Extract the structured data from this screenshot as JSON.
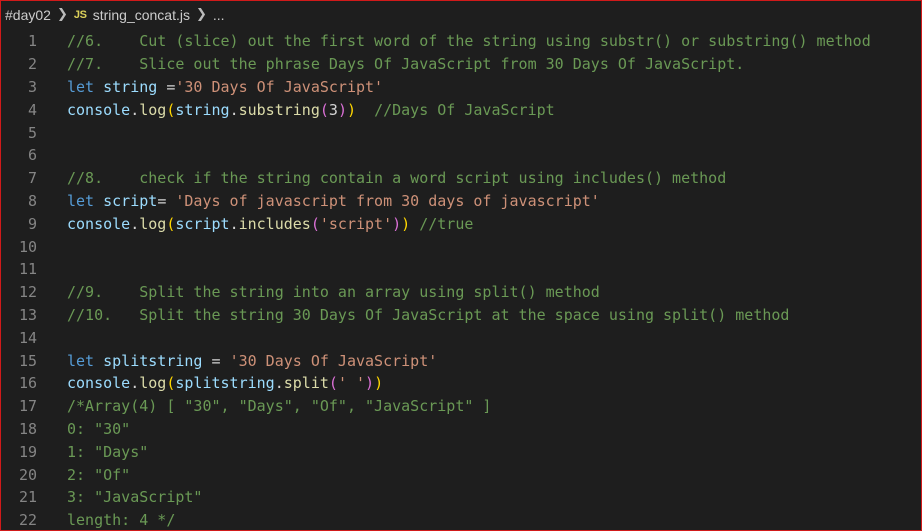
{
  "breadcrumb": {
    "folder": "#day02",
    "file_icon": "JS",
    "file": "string_concat.js",
    "more": "..."
  },
  "editor": {
    "lines": [
      {
        "n": "1",
        "tokens": [
          [
            "c-comment",
            "//6.    Cut (slice) out the first word of the string using substr() or substring() method"
          ]
        ]
      },
      {
        "n": "2",
        "tokens": [
          [
            "c-comment",
            "//7.    Slice out the phrase Days Of JavaScript from 30 Days Of JavaScript."
          ]
        ]
      },
      {
        "n": "3",
        "tokens": [
          [
            "c-kw",
            "let"
          ],
          [
            "c-punc",
            " "
          ],
          [
            "c-var",
            "string"
          ],
          [
            "c-punc",
            " ="
          ],
          [
            "c-str",
            "'30 Days Of JavaScript'"
          ]
        ]
      },
      {
        "n": "4",
        "tokens": [
          [
            "c-var",
            "console"
          ],
          [
            "c-punc",
            "."
          ],
          [
            "c-fn",
            "log"
          ],
          [
            "c-p1",
            "("
          ],
          [
            "c-var",
            "string"
          ],
          [
            "c-punc",
            "."
          ],
          [
            "c-fn",
            "substring"
          ],
          [
            "c-p2",
            "("
          ],
          [
            "c-punc",
            "3"
          ],
          [
            "c-p2",
            ")"
          ],
          [
            "c-p1",
            ")"
          ],
          [
            "c-punc",
            "  "
          ],
          [
            "c-comment",
            "//Days Of JavaScript"
          ]
        ]
      },
      {
        "n": "5",
        "tokens": []
      },
      {
        "n": "6",
        "tokens": []
      },
      {
        "n": "7",
        "tokens": [
          [
            "c-comment",
            "//8.    check if the string contain a word script using includes() method"
          ]
        ]
      },
      {
        "n": "8",
        "tokens": [
          [
            "c-kw",
            "let"
          ],
          [
            "c-punc",
            " "
          ],
          [
            "c-var",
            "script"
          ],
          [
            "c-punc",
            "= "
          ],
          [
            "c-str",
            "'Days of javascript from 30 days of javascript'"
          ]
        ]
      },
      {
        "n": "9",
        "tokens": [
          [
            "c-var",
            "console"
          ],
          [
            "c-punc",
            "."
          ],
          [
            "c-fn",
            "log"
          ],
          [
            "c-p1",
            "("
          ],
          [
            "c-var",
            "script"
          ],
          [
            "c-punc",
            "."
          ],
          [
            "c-fn",
            "includes"
          ],
          [
            "c-p2",
            "("
          ],
          [
            "c-str",
            "'script'"
          ],
          [
            "c-p2",
            ")"
          ],
          [
            "c-p1",
            ")"
          ],
          [
            "c-punc",
            " "
          ],
          [
            "c-comment",
            "//true"
          ]
        ]
      },
      {
        "n": "10",
        "tokens": []
      },
      {
        "n": "11",
        "tokens": []
      },
      {
        "n": "12",
        "tokens": [
          [
            "c-comment",
            "//9.    Split the string into an array using split() method"
          ]
        ]
      },
      {
        "n": "13",
        "tokens": [
          [
            "c-comment",
            "//10.   Split the string 30 Days Of JavaScript at the space using split() method"
          ]
        ]
      },
      {
        "n": "14",
        "tokens": []
      },
      {
        "n": "15",
        "tokens": [
          [
            "c-kw",
            "let"
          ],
          [
            "c-punc",
            " "
          ],
          [
            "c-var",
            "splitstring"
          ],
          [
            "c-punc",
            " = "
          ],
          [
            "c-str",
            "'30 Days Of JavaScript'"
          ]
        ]
      },
      {
        "n": "16",
        "tokens": [
          [
            "c-var",
            "console"
          ],
          [
            "c-punc",
            "."
          ],
          [
            "c-fn",
            "log"
          ],
          [
            "c-p1",
            "("
          ],
          [
            "c-var",
            "splitstring"
          ],
          [
            "c-punc",
            "."
          ],
          [
            "c-fn",
            "split"
          ],
          [
            "c-p2",
            "("
          ],
          [
            "c-str",
            "' '"
          ],
          [
            "c-p2",
            ")"
          ],
          [
            "c-p1",
            ")"
          ]
        ]
      },
      {
        "n": "17",
        "tokens": [
          [
            "c-comment",
            "/*Array(4) [ \"30\", \"Days\", \"Of\", \"JavaScript\" ]"
          ]
        ]
      },
      {
        "n": "18",
        "tokens": [
          [
            "c-comment",
            "0: \"30\""
          ]
        ]
      },
      {
        "n": "19",
        "tokens": [
          [
            "c-comment",
            "1: \"Days\""
          ]
        ]
      },
      {
        "n": "20",
        "tokens": [
          [
            "c-comment",
            "2: \"Of\""
          ]
        ]
      },
      {
        "n": "21",
        "tokens": [
          [
            "c-comment",
            "3: \"JavaScript\""
          ]
        ]
      },
      {
        "n": "22",
        "tokens": [
          [
            "c-comment",
            "length: 4 */"
          ]
        ]
      }
    ]
  }
}
